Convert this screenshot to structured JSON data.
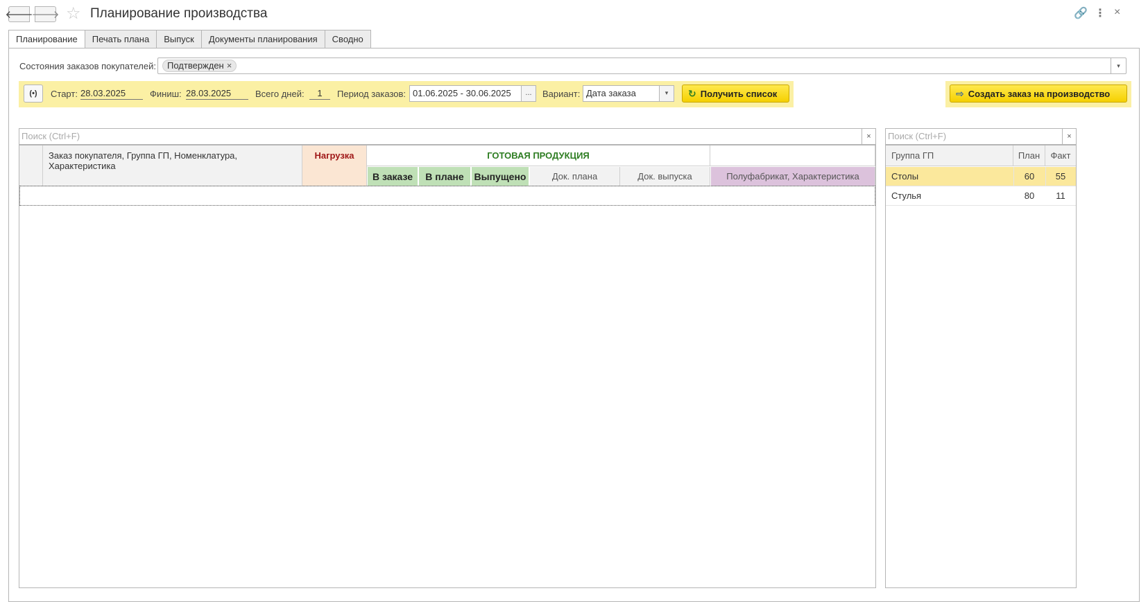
{
  "window": {
    "title": "Планирование производства",
    "back_glyph": "🡐",
    "forward_glyph": "🡒",
    "star_glyph": "☆",
    "link_glyph": "🔗",
    "menu_glyph": "⋮",
    "close_glyph": "×"
  },
  "tabs": [
    {
      "label": "Планирование",
      "active": true
    },
    {
      "label": "Печать плана",
      "active": false
    },
    {
      "label": "Выпуск",
      "active": false
    },
    {
      "label": "Документы планирования",
      "active": false
    },
    {
      "label": "Сводно",
      "active": false
    }
  ],
  "filters": {
    "states_label": "Состояния заказов покупателей:",
    "states_chip": "Подтвержден",
    "chip_remove_glyph": "×",
    "dropdown_glyph": "▾",
    "signal_glyph": "(•)",
    "start_label": "Старт:",
    "start_value": "28.03.2025",
    "finish_label": "Финиш:",
    "finish_value": "28.03.2025",
    "days_label": "Всего дней:",
    "days_value": "1",
    "period_label": "Период заказов:",
    "period_value": "01.06.2025 - 30.06.2025",
    "period_picker_glyph": "...",
    "variant_label": "Вариант:",
    "variant_value": "Дата заказа",
    "get_list_label": "Получить список",
    "get_list_glyph": "↻",
    "create_order_label": "Создать заказ на производство",
    "create_order_glyph": "⇨"
  },
  "search": {
    "main_placeholder": "Поиск (Ctrl+F)",
    "side_placeholder": "Поиск (Ctrl+F)",
    "clear_glyph": "×"
  },
  "main_table": {
    "col_order": "Заказ покупателя, Группа ГП, Номенклатура, Характеристика",
    "col_load": "Нагрузка",
    "group_finished": "ГОТОВАЯ ПРОДУКЦИЯ",
    "col_in_order": "В заказе",
    "col_in_plan": "В плане",
    "col_released": "Выпущено",
    "col_plan_doc": "Док. плана",
    "col_release_doc": "Док. выпуска",
    "col_semifinished": "Полуфабрикат, Характеристика"
  },
  "side_table": {
    "col_group": "Группа ГП",
    "col_plan": "План",
    "col_fact": "Факт",
    "rows": [
      {
        "group": "Столы",
        "plan": "60",
        "fact": "55",
        "selected": true
      },
      {
        "group": "Стулья",
        "plan": "80",
        "fact": "11",
        "selected": false
      }
    ]
  },
  "colors": {
    "accent_yellow": "#fbf0a4",
    "button_yellow": "#f5d000",
    "finished_green": "#2e7d22",
    "load_red": "#a01818",
    "load_bg": "#fbe6d3",
    "semifinished_bg": "#dcc2dc",
    "selected_row": "#fbe89c"
  }
}
